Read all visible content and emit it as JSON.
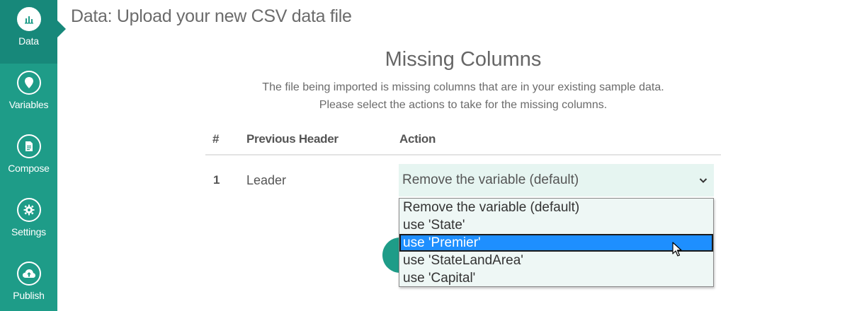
{
  "sidebar": {
    "items": [
      {
        "label": "Data",
        "icon": "bar-chart-icon"
      },
      {
        "label": "Variables",
        "icon": "map-pin-icon"
      },
      {
        "label": "Compose",
        "icon": "document-icon"
      },
      {
        "label": "Settings",
        "icon": "gear-icon"
      },
      {
        "label": "Publish",
        "icon": "cloud-upload-icon"
      }
    ],
    "accent": "#1e9c88"
  },
  "page": {
    "title": "Data: Upload your new CSV data file"
  },
  "missing": {
    "title": "Missing Columns",
    "line1": "The file being imported is missing columns that are in your existing sample data.",
    "line2": "Please select the actions to take for the missing columns."
  },
  "table": {
    "headers": [
      "#",
      "Previous Header",
      "Action"
    ],
    "rows": [
      {
        "num": "1",
        "header": "Leader",
        "action": "Remove the variable (default)"
      }
    ]
  },
  "dropdown": {
    "options": [
      "Remove the variable (default)",
      "use 'State'",
      "use 'Premier'",
      "use 'StateLandArea'",
      "use 'Capital'"
    ],
    "highlighted_index": 2,
    "highlight_color": "#1e8fff"
  }
}
